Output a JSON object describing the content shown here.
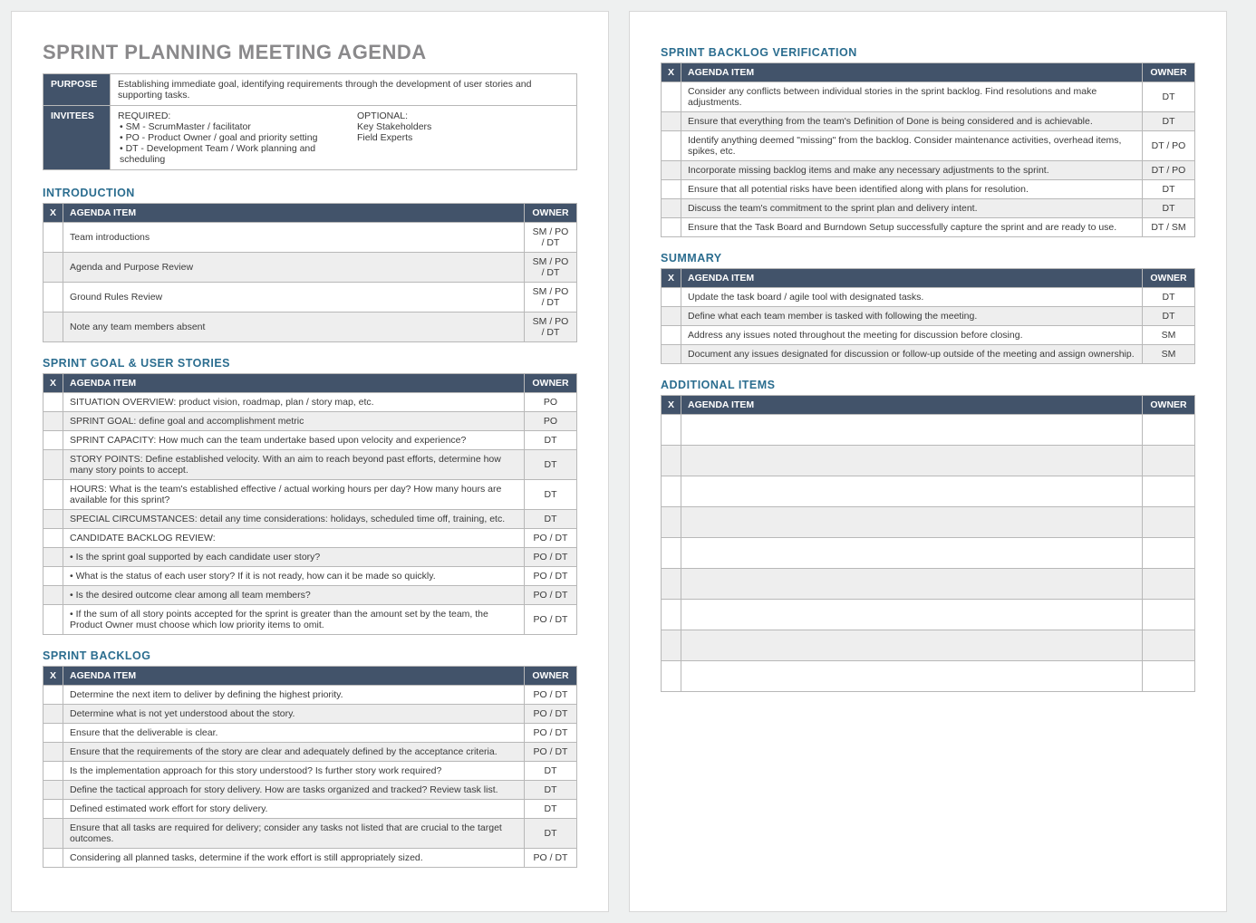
{
  "doc": {
    "title": "SPRINT PLANNING MEETING AGENDA"
  },
  "purpose": {
    "label": "PURPOSE",
    "text": "Establishing immediate goal, identifying requirements through the development of user stories and supporting tasks."
  },
  "invitees": {
    "label": "INVITEES",
    "required_heading": "REQUIRED:",
    "required_1": "• SM - ScrumMaster / facilitator",
    "required_2": "• PO - Product Owner / goal and priority setting",
    "required_3": "• DT - Development Team / Work planning and scheduling",
    "optional_heading": "OPTIONAL:",
    "optional_1": "Key Stakeholders",
    "optional_2": "Field Experts"
  },
  "headers": {
    "x": "X",
    "agenda_item": "AGENDA ITEM",
    "owner": "OWNER"
  },
  "sections": {
    "introduction": {
      "title": "INTRODUCTION",
      "rows": [
        {
          "item": "Team introductions",
          "owner": "SM / PO / DT"
        },
        {
          "item": "Agenda and Purpose Review",
          "owner": "SM / PO / DT"
        },
        {
          "item": "Ground Rules Review",
          "owner": "SM / PO / DT"
        },
        {
          "item": "Note any team members absent",
          "owner": "SM / PO / DT"
        }
      ]
    },
    "goal_stories": {
      "title": "SPRINT GOAL & USER STORIES",
      "rows": [
        {
          "item": "SITUATION OVERVIEW: product vision, roadmap, plan / story map, etc.",
          "owner": "PO"
        },
        {
          "item": "SPRINT GOAL: define goal and accomplishment metric",
          "owner": "PO"
        },
        {
          "item": "SPRINT CAPACITY: How much can the team undertake based upon velocity and experience?",
          "owner": "DT"
        },
        {
          "item": "STORY POINTS: Define established velocity. With an aim to reach beyond past efforts, determine how many story points to accept.",
          "owner": "DT"
        },
        {
          "item": "HOURS: What is the team's established effective / actual working hours per day? How many hours are available for this sprint?",
          "owner": "DT"
        },
        {
          "item": "SPECIAL CIRCUMSTANCES: detail any time considerations: holidays, scheduled time off, training, etc.",
          "owner": "DT"
        },
        {
          "item": "CANDIDATE BACKLOG REVIEW:",
          "owner": "PO / DT"
        },
        {
          "item": "• Is the sprint goal supported by each candidate user story?",
          "owner": "PO / DT"
        },
        {
          "item": "• What is the status of each user story? If it is not ready, how can it be made so quickly.",
          "owner": "PO / DT"
        },
        {
          "item": "• Is the desired outcome clear among all team members?",
          "owner": "PO / DT"
        },
        {
          "item": "• If the sum of all story points accepted for the sprint is greater than the amount set by the team, the Product Owner must choose which low priority items to omit.",
          "owner": "PO / DT"
        }
      ]
    },
    "sprint_backlog": {
      "title": "SPRINT BACKLOG",
      "rows": [
        {
          "item": "Determine the next item to deliver by defining the highest priority.",
          "owner": "PO / DT"
        },
        {
          "item": "Determine what is not yet understood about the story.",
          "owner": "PO / DT"
        },
        {
          "item": "Ensure that the deliverable is clear.",
          "owner": "PO / DT"
        },
        {
          "item": "Ensure that the requirements of the story are clear and adequately defined by the acceptance criteria.",
          "owner": "PO / DT"
        },
        {
          "item": "Is the implementation approach for this story understood?  Is further story work required?",
          "owner": "DT"
        },
        {
          "item": "Define the tactical approach for story delivery.  How are tasks organized and tracked? Review task list.",
          "owner": "DT"
        },
        {
          "item": "Defined estimated work effort for story delivery.",
          "owner": "DT"
        },
        {
          "item": "Ensure that all tasks are required for delivery; consider any tasks not listed that are crucial to the target outcomes.",
          "owner": "DT"
        },
        {
          "item": "Considering all planned tasks, determine if the work effort is still appropriately sized.",
          "owner": "PO / DT"
        }
      ]
    },
    "backlog_verification": {
      "title": "SPRINT BACKLOG VERIFICATION",
      "rows": [
        {
          "item": "Consider any conflicts between individual stories in the sprint backlog. Find resolutions and make adjustments.",
          "owner": "DT"
        },
        {
          "item": "Ensure that everything from the team's Definition of Done is being considered and is achievable.",
          "owner": "DT"
        },
        {
          "item": "Identify anything deemed \"missing\" from the backlog. Consider maintenance activities, overhead items, spikes, etc.",
          "owner": "DT / PO"
        },
        {
          "item": "Incorporate missing backlog items and make any necessary adjustments to the sprint.",
          "owner": "DT / PO"
        },
        {
          "item": "Ensure that all potential risks have been identified along with plans for resolution.",
          "owner": "DT"
        },
        {
          "item": "Discuss the team's commitment to the sprint plan and delivery intent.",
          "owner": "DT"
        },
        {
          "item": "Ensure that the Task Board and Burndown Setup successfully capture the sprint and are ready to use.",
          "owner": "DT / SM"
        }
      ]
    },
    "summary": {
      "title": "SUMMARY",
      "rows": [
        {
          "item": "Update the task board / agile tool with designated tasks.",
          "owner": "DT"
        },
        {
          "item": "Define what each team member is tasked with following the meeting.",
          "owner": "DT"
        },
        {
          "item": "Address any issues noted throughout the meeting for discussion before closing.",
          "owner": "SM"
        },
        {
          "item": "Document any issues designated for discussion or follow-up outside of the meeting and assign ownership.",
          "owner": "SM"
        }
      ]
    },
    "additional": {
      "title": "ADDITIONAL ITEMS",
      "blank_rows": 9
    }
  }
}
